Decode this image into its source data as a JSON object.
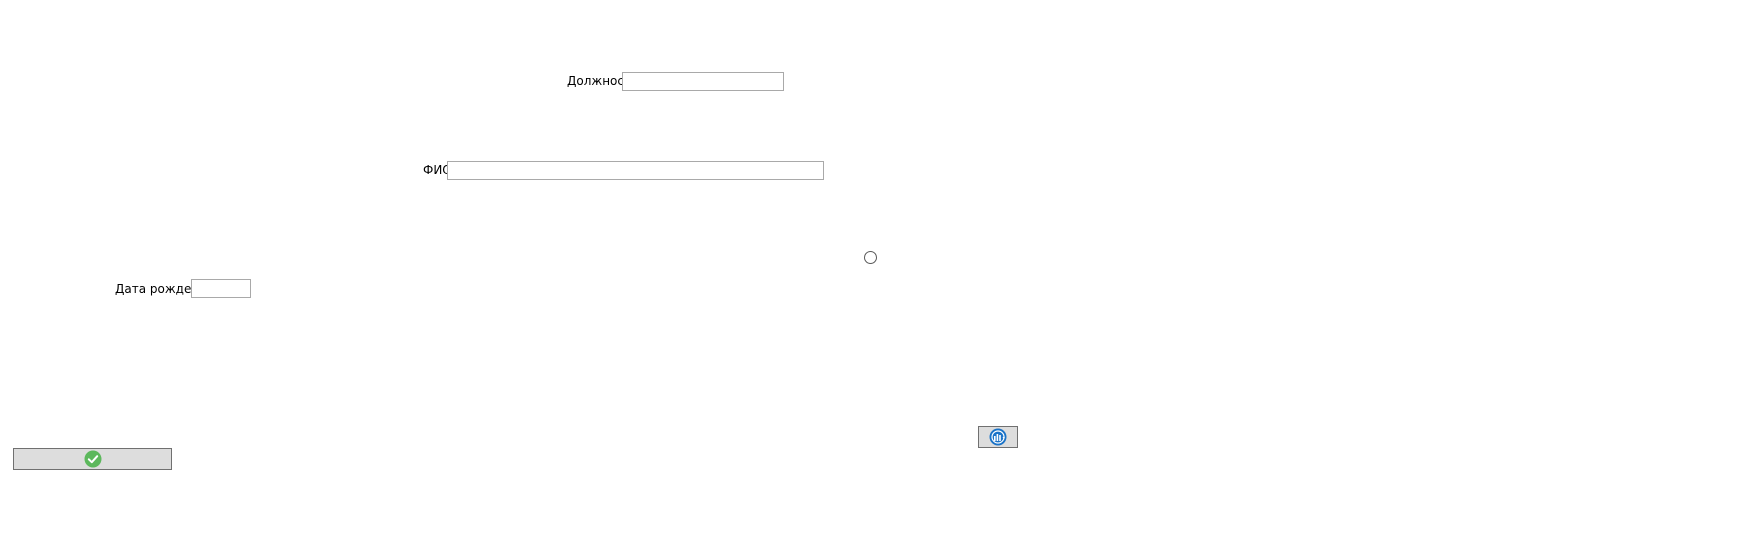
{
  "form": {
    "position_label": "Должность",
    "position_value": "",
    "fio_label": "ФИО",
    "fio_value": "",
    "birthdate_label": "Дата рождения",
    "birthdate_value": ""
  },
  "buttons": {
    "confirm_icon": "check-circle-icon",
    "confirm_icon_color": "#5cb85c",
    "refresh_icon": "refresh-chart-icon",
    "refresh_icon_color": "#1a73c8"
  },
  "radio": {
    "checked": false
  }
}
